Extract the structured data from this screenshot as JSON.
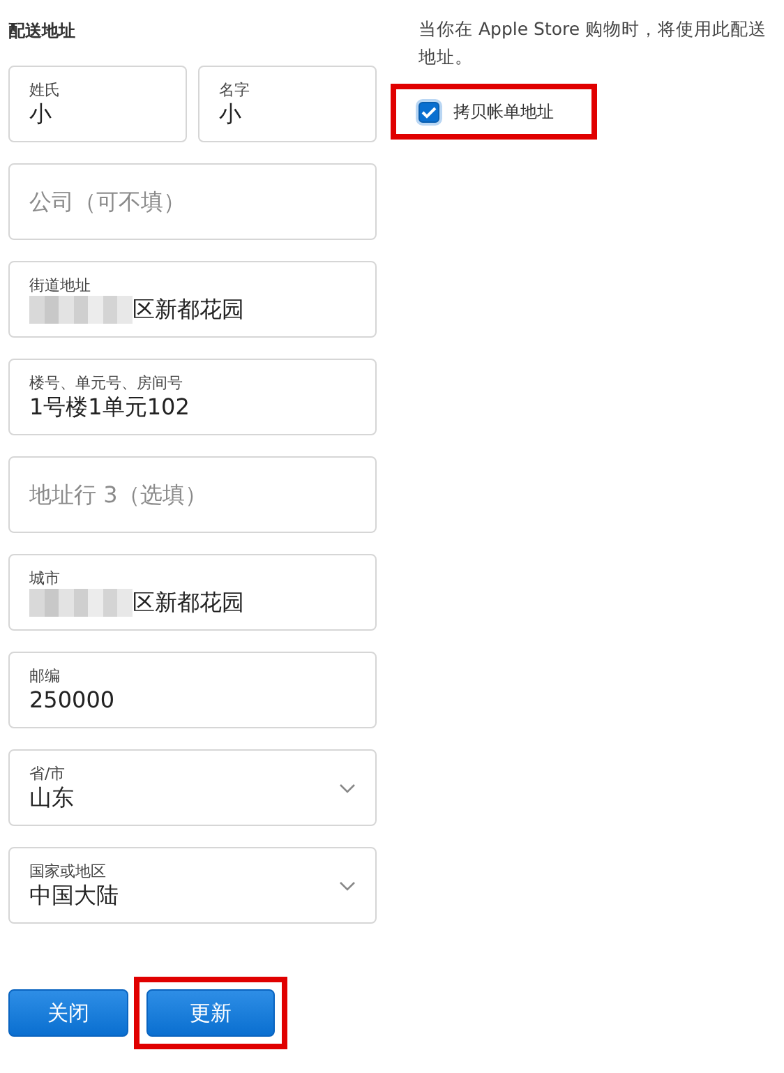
{
  "heading": "配送地址",
  "name_fields": [
    {
      "label": "姓氏",
      "value": "小"
    },
    {
      "label": "名字",
      "value": "小"
    }
  ],
  "fields": [
    {
      "kind": "text",
      "placeholder": "公司（可不填）"
    },
    {
      "kind": "text",
      "label": "街道地址",
      "value": "区新都花园",
      "blurred": true
    },
    {
      "kind": "text",
      "label": "楼号、单元号、房间号",
      "value": "1号楼1单元102"
    },
    {
      "kind": "text",
      "placeholder": "地址行 3（选填）"
    },
    {
      "kind": "text",
      "label": "城市",
      "value": "区新都花园",
      "blurred": true
    },
    {
      "kind": "text",
      "label": "邮编",
      "value": "250000"
    },
    {
      "kind": "select",
      "label": "省/市",
      "value": "山东"
    },
    {
      "kind": "select",
      "label": "国家或地区",
      "value": "中国大陆"
    }
  ],
  "note": "当你在 Apple Store 购物时，将使用此配送地址。",
  "copy_billing": {
    "label": "拷贝帐单地址",
    "checked": true,
    "highlighted": true
  },
  "buttons": [
    {
      "label": "关闭",
      "highlighted": false
    },
    {
      "label": "更新",
      "highlighted": true
    }
  ]
}
